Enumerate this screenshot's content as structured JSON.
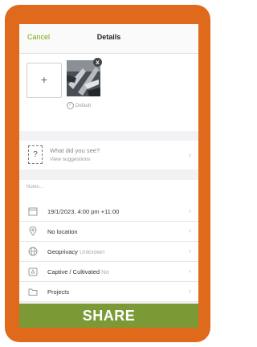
{
  "nav": {
    "cancel_label": "Cancel",
    "title": "Details"
  },
  "photo": {
    "add_label": "+",
    "remove_label": "x",
    "default_label": "Default"
  },
  "identify": {
    "title": "What did you see?",
    "subtitle": "View suggestions",
    "icon": "question-box-icon"
  },
  "notes": {
    "placeholder": "Notes..."
  },
  "rows": [
    {
      "icon": "calendar-icon",
      "label": "19/1/2023, 4:00 pm +11:00",
      "value": ""
    },
    {
      "icon": "location-pin-icon",
      "label": "No location",
      "value": ""
    },
    {
      "icon": "globe-icon",
      "label": "Geoprivacy",
      "value": "Unknown"
    },
    {
      "icon": "pot-icon",
      "label": "Captive / Cultivated",
      "value": "No"
    },
    {
      "icon": "folder-icon",
      "label": "Projects",
      "value": ""
    }
  ],
  "chevron": "›",
  "share_label": "SHARE",
  "colors": {
    "frame": "#e06a1c",
    "accent": "#74ac00",
    "share": "#7b9a36"
  }
}
